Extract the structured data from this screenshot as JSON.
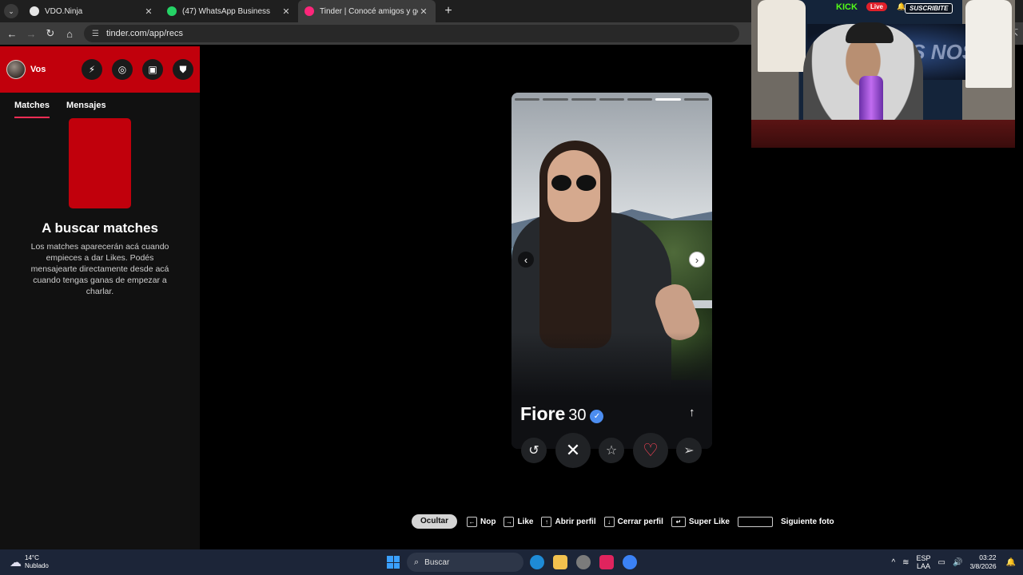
{
  "browser": {
    "tabs": [
      {
        "title": "VDO.Ninja",
        "favicon_color": "#e6e6e6",
        "active": false
      },
      {
        "title": "(47) WhatsApp Business",
        "favicon_color": "#25d366",
        "active": false
      },
      {
        "title": "Tinder | Conocé amigos y gente nueva",
        "favicon_color": "#fd267a",
        "active": true
      }
    ],
    "url": "tinder.com/app/recs"
  },
  "sidebar": {
    "user_name": "Vos",
    "tabs": [
      "Matches",
      "Mensajes"
    ],
    "empty_title": "A buscar matches",
    "empty_desc": "Los matches aparecerán acá cuando empieces a dar Likes. Podés mensajearte directamente desde acá cuando tengas ganas de empezar a charlar."
  },
  "profile": {
    "name": "Fiore",
    "age": "30",
    "photo_count": 7,
    "current_photo": 6
  },
  "shortcuts": {
    "hide_label": "Ocultar",
    "items": [
      {
        "key": "←",
        "label": "Nop"
      },
      {
        "key": "→",
        "label": "Like"
      },
      {
        "key": "↑",
        "label": "Abrir perfil"
      },
      {
        "key": "↓",
        "label": "Cerrar perfil"
      },
      {
        "key": "↵",
        "label": "Super Like"
      },
      {
        "key": "",
        "label": "Siguiente foto"
      }
    ]
  },
  "stream_overlay": {
    "platform": "KICK",
    "live": "Live",
    "subscribe": "SUSCRIBITE",
    "banner": "OS NOS"
  },
  "taskbar": {
    "temperature": "14°C",
    "weather": "Nublado",
    "search_placeholder": "Buscar",
    "language": "ESP",
    "layout": "LAA",
    "time": "03:22",
    "date": "3/8/2026"
  },
  "colors": {
    "brand": "#c1000c",
    "like": "#ff4458"
  }
}
